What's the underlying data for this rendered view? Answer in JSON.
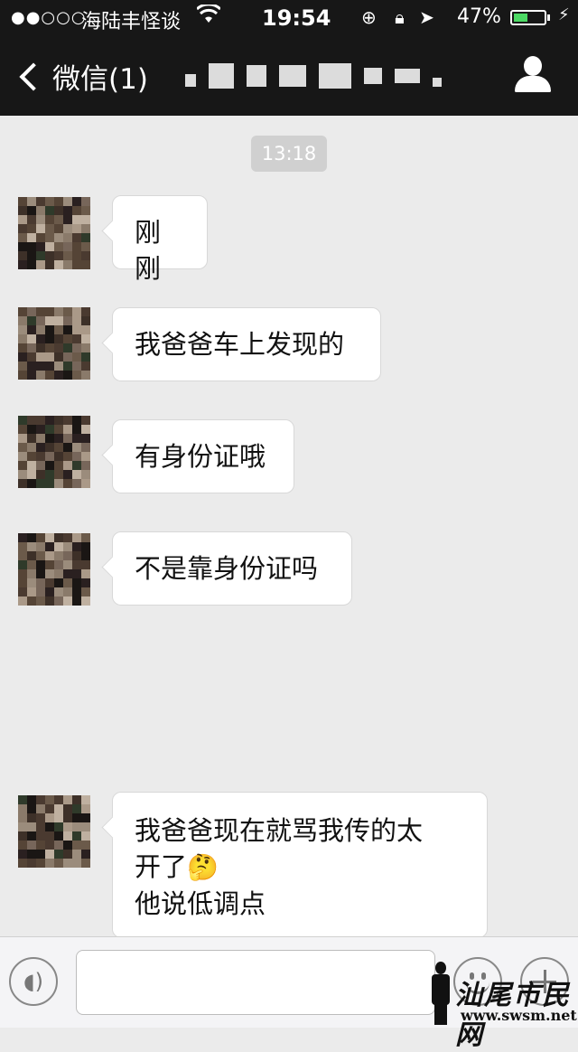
{
  "status_bar": {
    "signal": "●●○○○",
    "carrier": "海陆丰怪谈",
    "time": "19:54",
    "battery_percent": "47%",
    "battery_level": 0.47,
    "icons": [
      "wifi-icon",
      "rotation-lock-icon",
      "location-icon",
      "charging-icon"
    ]
  },
  "nav": {
    "back_label": "微信(1)",
    "title_obscured": true
  },
  "chat": {
    "timestamp": "13:18",
    "messages": [
      {
        "text": "刚刚"
      },
      {
        "text": "我爸爸车上发现的"
      },
      {
        "text": "有身份证哦"
      },
      {
        "text": "不是靠身份证吗"
      },
      {
        "line1": "我爸爸现在就骂我传的太",
        "line2": "开了",
        "emoji": "🤔",
        "line3": "他说低调点"
      }
    ]
  },
  "input_bar": {
    "value": "",
    "placeholder": ""
  },
  "watermark": {
    "text": "汕尾市民网",
    "url": "www.swsm.net"
  },
  "colors": {
    "nav_bg": "#171717",
    "chat_bg": "#ebebeb",
    "bubble_bg": "#ffffff",
    "battery_fill": "#4cd964"
  }
}
